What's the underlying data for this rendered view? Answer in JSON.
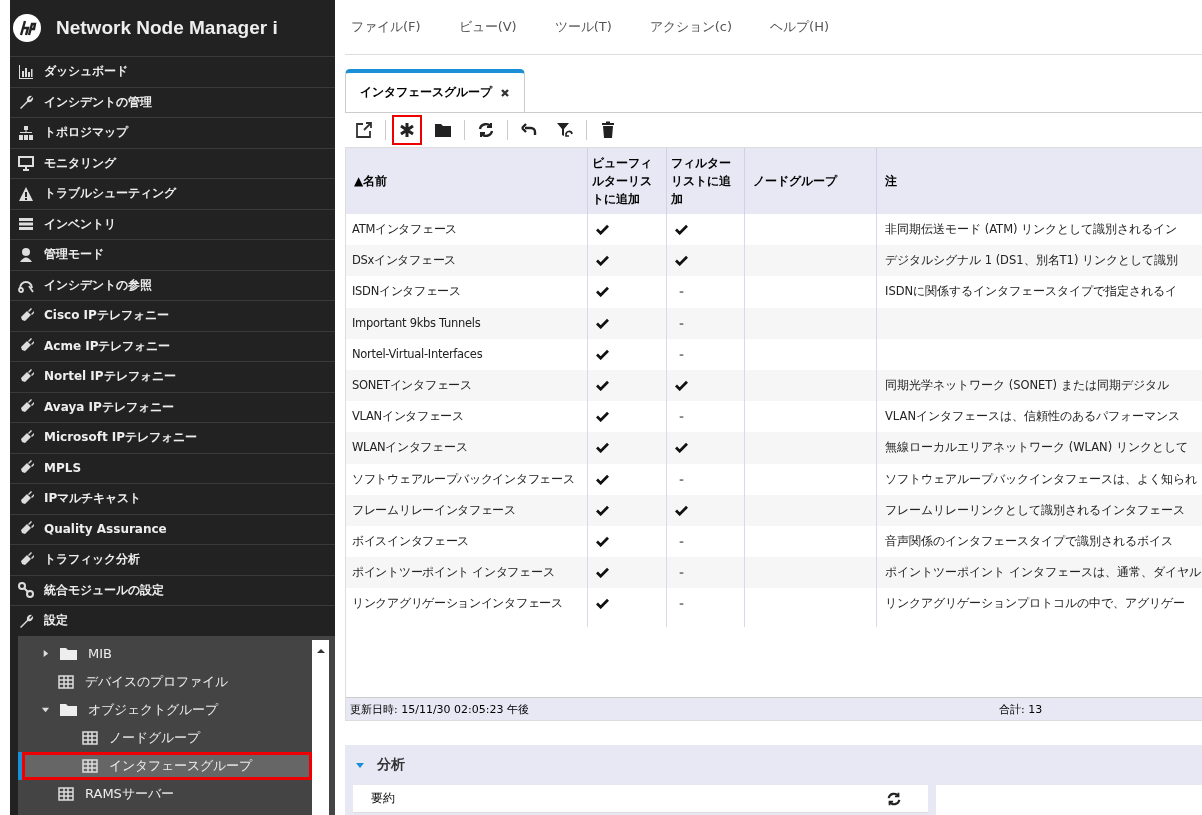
{
  "app": {
    "title": "Network Node Manager i"
  },
  "nav": [
    {
      "label": "ダッシュボード"
    },
    {
      "label": "インシデントの管理"
    },
    {
      "label": "トポロジマップ"
    },
    {
      "label": "モニタリング"
    },
    {
      "label": "トラブルシューティング"
    },
    {
      "label": "インベントリ"
    },
    {
      "label": "管理モード"
    },
    {
      "label": "インシデントの参照"
    },
    {
      "label": "Cisco IPテレフォニー"
    },
    {
      "label": "Acme IPテレフォニー"
    },
    {
      "label": "Nortel IPテレフォニー"
    },
    {
      "label": "Avaya IPテレフォニー"
    },
    {
      "label": "Microsoft IPテレフォニー"
    },
    {
      "label": "MPLS"
    },
    {
      "label": "IPマルチキャスト"
    },
    {
      "label": "Quality Assurance"
    },
    {
      "label": "トラフィック分析"
    },
    {
      "label": "統合モジュールの設定"
    },
    {
      "label": "設定"
    }
  ],
  "tree": [
    {
      "label": "MIB",
      "kind": "folder",
      "expanded": false,
      "selected": false,
      "highlighted": false
    },
    {
      "label": "デバイスのプロファイル",
      "kind": "table",
      "selected": false,
      "highlighted": false
    },
    {
      "label": "オブジェクトグループ",
      "kind": "folder",
      "expanded": true,
      "selected": false,
      "highlighted": false,
      "children": [
        {
          "label": "ノードグループ",
          "kind": "table",
          "selected": false,
          "highlighted": false
        },
        {
          "label": "インタフェースグループ",
          "kind": "table",
          "selected": true,
          "highlighted": true
        }
      ]
    },
    {
      "label": "RAMSサーバー",
      "kind": "table",
      "selected": false,
      "highlighted": false
    }
  ],
  "menu": [
    "ファイル(F)",
    "ビュー(V)",
    "ツール(T)",
    "アクション(c)",
    "ヘルプ(H)"
  ],
  "tabs": [
    {
      "label": "インタフェースグループ",
      "selected": true
    }
  ],
  "toolbar": [
    {
      "highlighted": false
    },
    {
      "highlighted": true
    },
    {
      "highlighted": false
    },
    {
      "highlighted": false
    },
    {
      "highlighted": false
    },
    {
      "highlighted": false
    },
    {
      "highlighted": false
    }
  ],
  "table": {
    "columns": [
      "▲名前",
      "ビューフィルターリストに追加",
      "フィルターリストに追加",
      "ノードグループ",
      "注"
    ],
    "rows": [
      {
        "name": "ATMインタフェース",
        "view_filter": true,
        "filter": true,
        "note": "非同期伝送モード (ATM) リンクとして識別されるイン"
      },
      {
        "name": "DSxインタフェース",
        "view_filter": true,
        "filter": true,
        "note": "デジタルシグナル 1 (DS1、別名T1) リンクとして識別"
      },
      {
        "name": "ISDNインタフェース",
        "view_filter": true,
        "filter": false,
        "note": "ISDNに関係するインタフェースタイプで指定されるイ"
      },
      {
        "name": "Important 9kbs Tunnels",
        "view_filter": true,
        "filter": false
      },
      {
        "name": "Nortel-Virtual-Interfaces",
        "view_filter": true,
        "filter": false
      },
      {
        "name": "SONETインタフェース",
        "view_filter": true,
        "filter": true,
        "note": "同期光学ネットワーク (SONET) または同期デジタル"
      },
      {
        "name": "VLANインタフェース",
        "view_filter": true,
        "filter": false,
        "note": "VLANインタフェースは、信頼性のあるパフォーマンス"
      },
      {
        "name": "WLANインタフェース",
        "view_filter": true,
        "filter": true,
        "note": "無線ローカルエリアネットワーク (WLAN) リンクとして"
      },
      {
        "name": "ソフトウェアループバックインタフェース",
        "view_filter": true,
        "filter": false,
        "note": "ソフトウェアループバックインタフェースは、よく知られ"
      },
      {
        "name": "フレームリレーインタフェース",
        "view_filter": true,
        "filter": true,
        "note": "フレームリレーリンクとして識別されるインタフェース"
      },
      {
        "name": "ボイスインタフェース",
        "view_filter": true,
        "filter": false,
        "note": "音声関係のインタフェースタイプで識別されるボイス"
      },
      {
        "name": "ポイントツーポイント インタフェース",
        "view_filter": true,
        "filter": false,
        "note": "ポイントツーポイント インタフェースは、通常、ダイヤル"
      },
      {
        "name": "リンクアグリゲーションインタフェース",
        "view_filter": true,
        "filter": false,
        "note": "リンクアグリゲーションプロトコルの中で、アグリゲー"
      }
    ]
  },
  "status_bar": {
    "updated": "更新日時: 15/11/30 02:05:23 午後",
    "total": "合計: 13"
  },
  "analysis": {
    "title": "分析",
    "expanded": true,
    "summary": "要約"
  }
}
